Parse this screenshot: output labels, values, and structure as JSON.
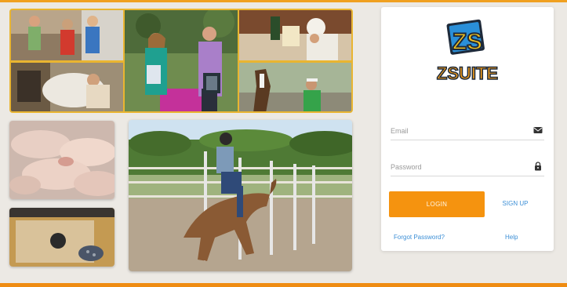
{
  "brand": {
    "logo_mark": "ZS",
    "logo_text": "ZSUITE",
    "accent_color": "#f5930f",
    "link_color": "#3c8fd6"
  },
  "login": {
    "email_placeholder": "Email",
    "password_placeholder": "Password",
    "login_label": "LOGIN",
    "signup_label": "SIGN UP",
    "forgot_label": "Forgot Password?",
    "help_label": "Help"
  },
  "icons": {
    "email": "envelope-icon",
    "password": "lock-icon"
  },
  "photos": [
    "kids-photo",
    "award-winners-photo",
    "chef-photo",
    "farm-worker-photo",
    "horse-and-child-photo",
    "piglets-photo",
    "target-practice-photo",
    "barrel-racing-photo"
  ]
}
